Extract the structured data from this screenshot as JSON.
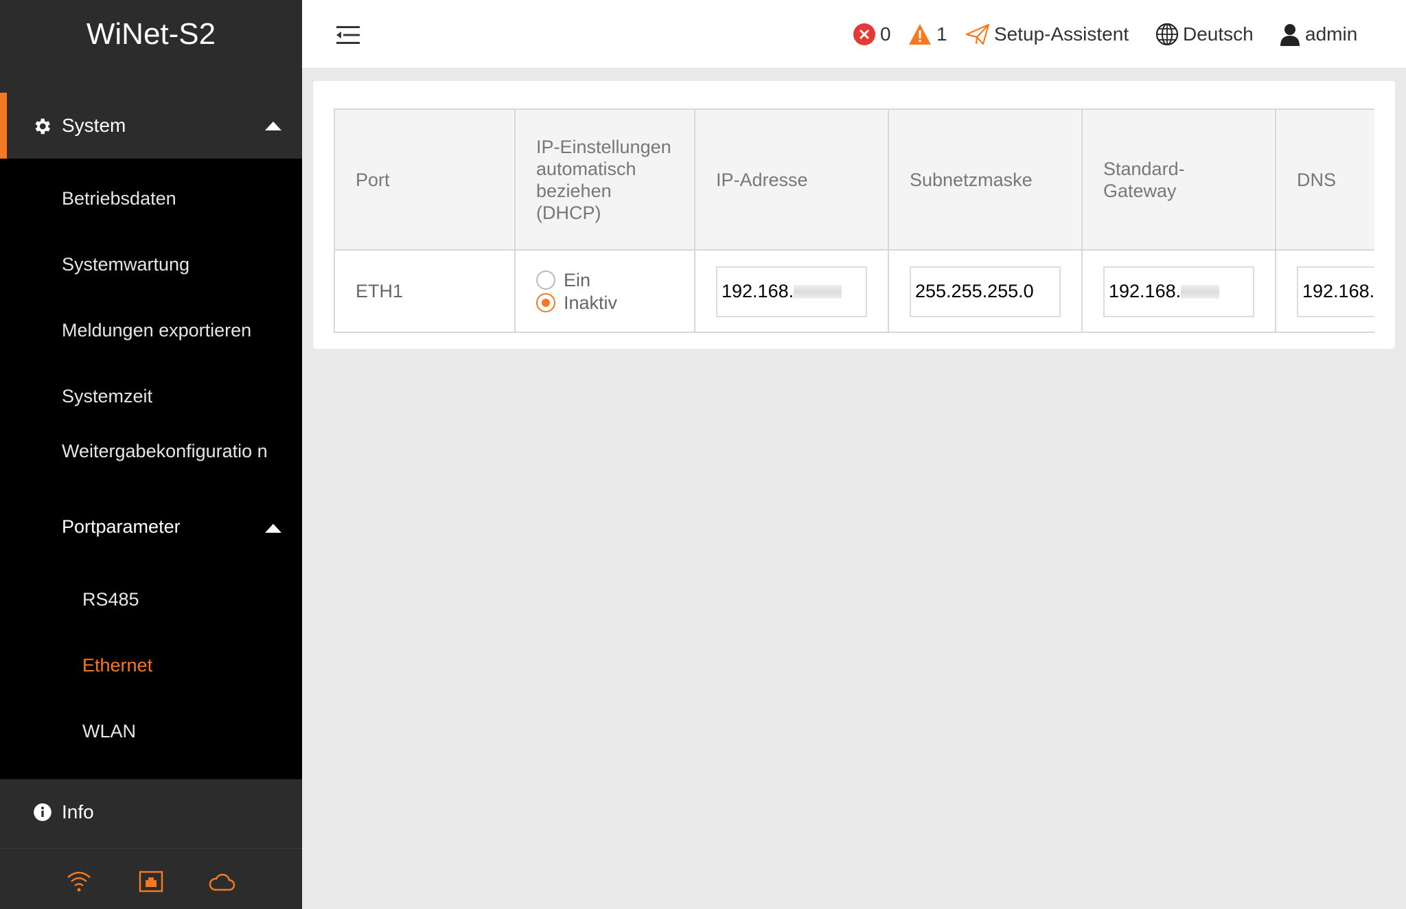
{
  "app": {
    "title": "WiNet-S2"
  },
  "sidebar": {
    "system_label": "System",
    "sub_items": [
      "Betriebsdaten",
      "Systemwartung",
      "Meldungen exportieren",
      "Systemzeit",
      "Weitergabekonfiguratio n"
    ],
    "portparam_label": "Portparameter",
    "port_items": [
      "RS485",
      "Ethernet",
      "WLAN"
    ],
    "info_label": "Info"
  },
  "header": {
    "errors_count": "0",
    "warnings_count": "1",
    "setup_label": "Setup-Assistent",
    "language_label": "Deutsch",
    "user_label": "admin"
  },
  "table": {
    "headers": [
      "Port",
      "IP-Einstellungen automatisch beziehen (DHCP)",
      "IP-Adresse",
      "Subnetzmaske",
      "Standard-Gateway",
      "DNS"
    ],
    "row": {
      "port": "ETH1",
      "dhcp_on": "Ein",
      "dhcp_off": "Inaktiv",
      "ip": "192.168.",
      "mask": "255.255.255.0",
      "gateway": "192.168.",
      "dns": "192.168."
    }
  },
  "colors": {
    "accent": "#f47920"
  }
}
